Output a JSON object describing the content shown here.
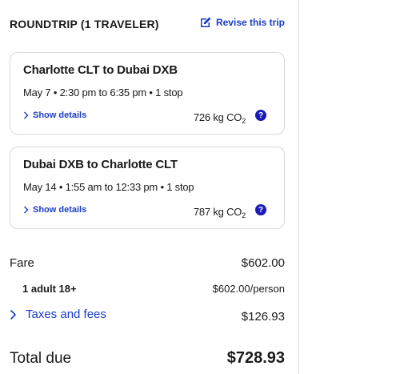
{
  "summary": {
    "title": "ROUNDTRIP (1 TRAVELER)",
    "revise_label": "Revise this trip"
  },
  "flights": [
    {
      "route": "Charlotte CLT to Dubai DXB",
      "times": "May 7 • 2:30 pm to 6:35 pm • 1 stop",
      "details_label": "Show details",
      "co2_value": "726 kg CO",
      "co2_sub": "2",
      "help": "?"
    },
    {
      "route": "Dubai DXB to Charlotte CLT",
      "times": "May 14 • 1:55 am to 12:33 pm • 1 stop",
      "details_label": "Show details",
      "co2_value": "787 kg CO",
      "co2_sub": "2",
      "help": "?"
    }
  ],
  "pricing": {
    "fare_label": "Fare",
    "fare_value": "$602.00",
    "adult_label": "1 adult 18+",
    "adult_value": "$602.00/person",
    "taxes_label": "Taxes and fees",
    "taxes_value": "$126.93",
    "total_label": "Total due",
    "total_value": "$728.93"
  },
  "colors": {
    "link": "#1a3cc7",
    "help_badge": "#1a1ab8",
    "text": "#1a1a1a",
    "border": "#d9d9d9"
  }
}
